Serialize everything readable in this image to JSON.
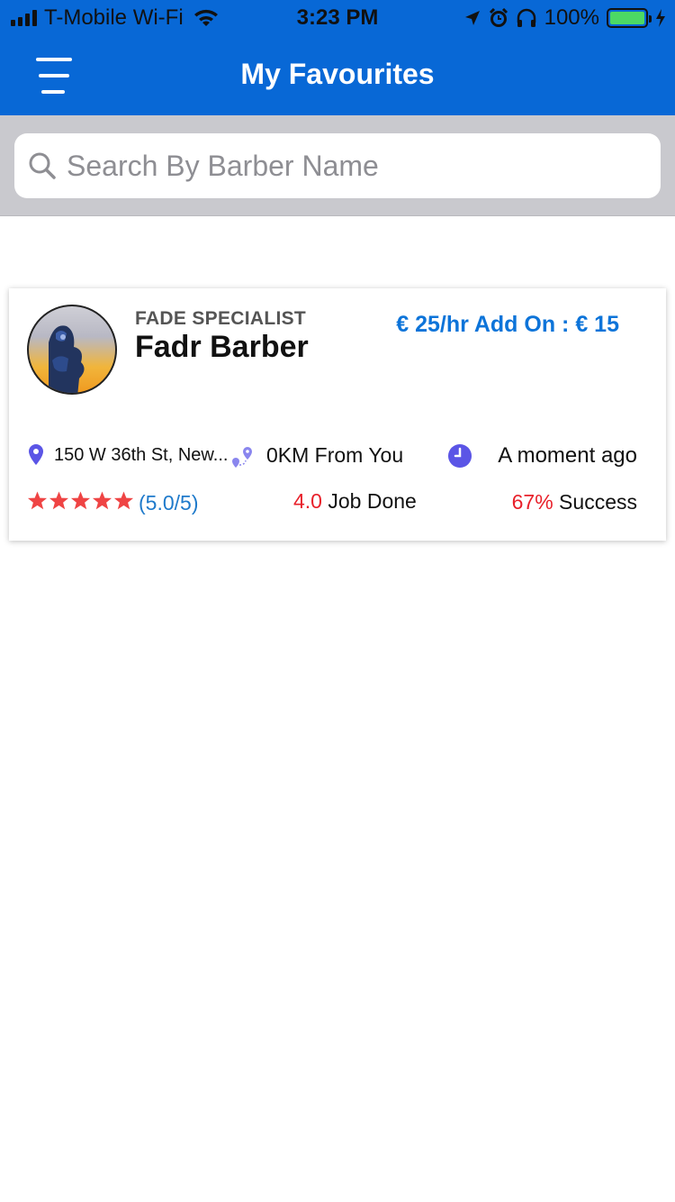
{
  "status_bar": {
    "carrier": "T-Mobile Wi-Fi",
    "time": "3:23 PM",
    "battery": "100%"
  },
  "header": {
    "title": "My Favourites"
  },
  "search": {
    "placeholder": "Search By Barber Name"
  },
  "barbers": [
    {
      "specialty": "FADE SPECIALIST",
      "name": "Fadr Barber",
      "price": "€ 25/hr Add On : € 15",
      "address": "150 W 36th St, New...",
      "distance": "0KM From You",
      "last_seen": "A moment ago",
      "rating_stars": 5,
      "rating_text": "(5.0/5)",
      "jobs_value": "4.0",
      "jobs_label": " Job Done",
      "success_value": "67%",
      "success_label": " Success"
    }
  ],
  "colors": {
    "primary": "#0868d6",
    "price_blue": "#0d74d9",
    "highlight_red": "#e8202a",
    "star_red": "#ef4444",
    "icon_purple": "#5b55e6"
  }
}
